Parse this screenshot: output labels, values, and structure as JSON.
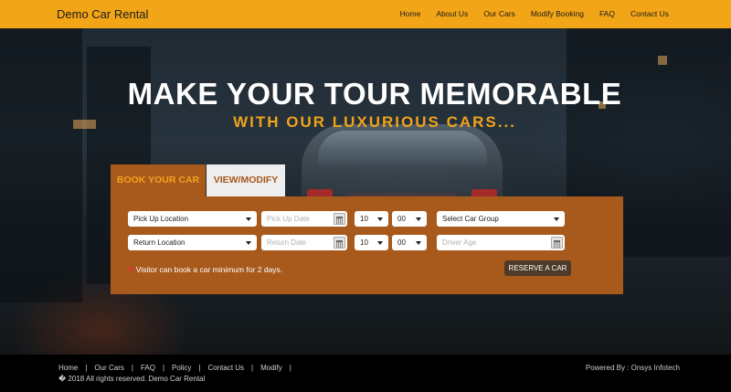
{
  "header": {
    "brand": "Demo Car Rental",
    "nav": [
      "Home",
      "About Us",
      "Our Cars",
      "Modify Booking",
      "FAQ",
      "Contact Us"
    ]
  },
  "hero": {
    "headline": "MAKE YOUR TOUR MEMORABLE",
    "subheadline": "WITH OUR LUXURIOUS CARS..."
  },
  "booking": {
    "tabs": [
      "BOOK YOUR CAR",
      "VIEW/MODIFY"
    ],
    "pickup_location": "Pick Up Location",
    "pickup_date_placeholder": "Pick Up Date",
    "pickup_hour": "10",
    "pickup_minute": "00",
    "car_group": "Select Car Group",
    "return_location": "Return Location",
    "return_date_placeholder": "Return Date",
    "return_hour": "10",
    "return_minute": "00",
    "driver_age_placeholder": "Driver Age",
    "note": "Visitor can book a car minimum for 2 days.",
    "reserve_label": "RESERVE A CAR",
    "accent_color": "#a85a1c"
  },
  "footer": {
    "links": [
      "Home",
      "Our Cars",
      "FAQ",
      "Policy",
      "Contact Us",
      "Modify"
    ],
    "copyright": "� 2018 All rights reserved. Demo Car Rental",
    "powered_by": "Powered By : Onsys Infotech"
  }
}
